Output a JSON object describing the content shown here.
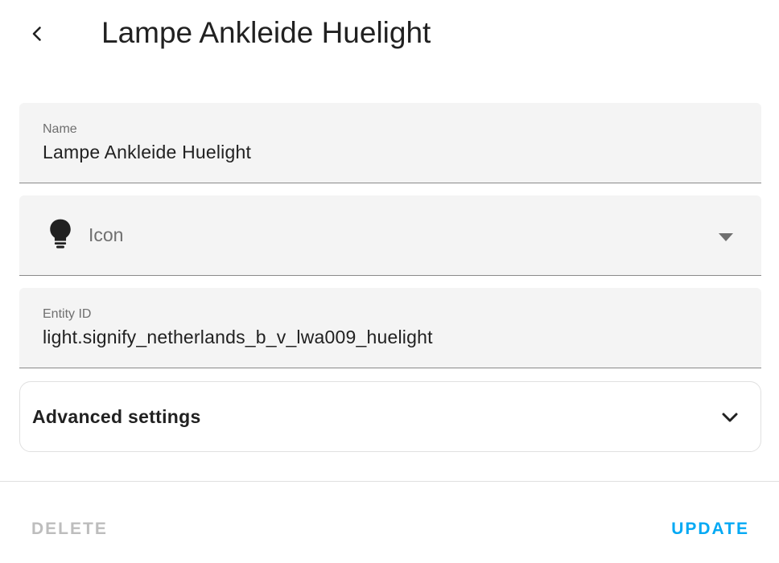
{
  "header": {
    "title": "Lampe Ankleide Huelight",
    "back_icon": "arrow-left-icon"
  },
  "form": {
    "name": {
      "label": "Name",
      "value": "Lampe Ankleide Huelight"
    },
    "icon": {
      "placeholder": "Icon",
      "icon": "lightbulb-icon",
      "dropdown_icon": "menu-down-icon"
    },
    "entity_id": {
      "label": "Entity ID",
      "value": "light.signify_netherlands_b_v_lwa009_huelight"
    }
  },
  "advanced": {
    "label": "Advanced settings",
    "expand_icon": "chevron-down-icon"
  },
  "footer": {
    "delete_label": "Delete",
    "update_label": "Update"
  },
  "colors": {
    "accent": "#03a9f4",
    "disabled": "#bdbdbd",
    "field_bg": "#f4f4f4"
  }
}
